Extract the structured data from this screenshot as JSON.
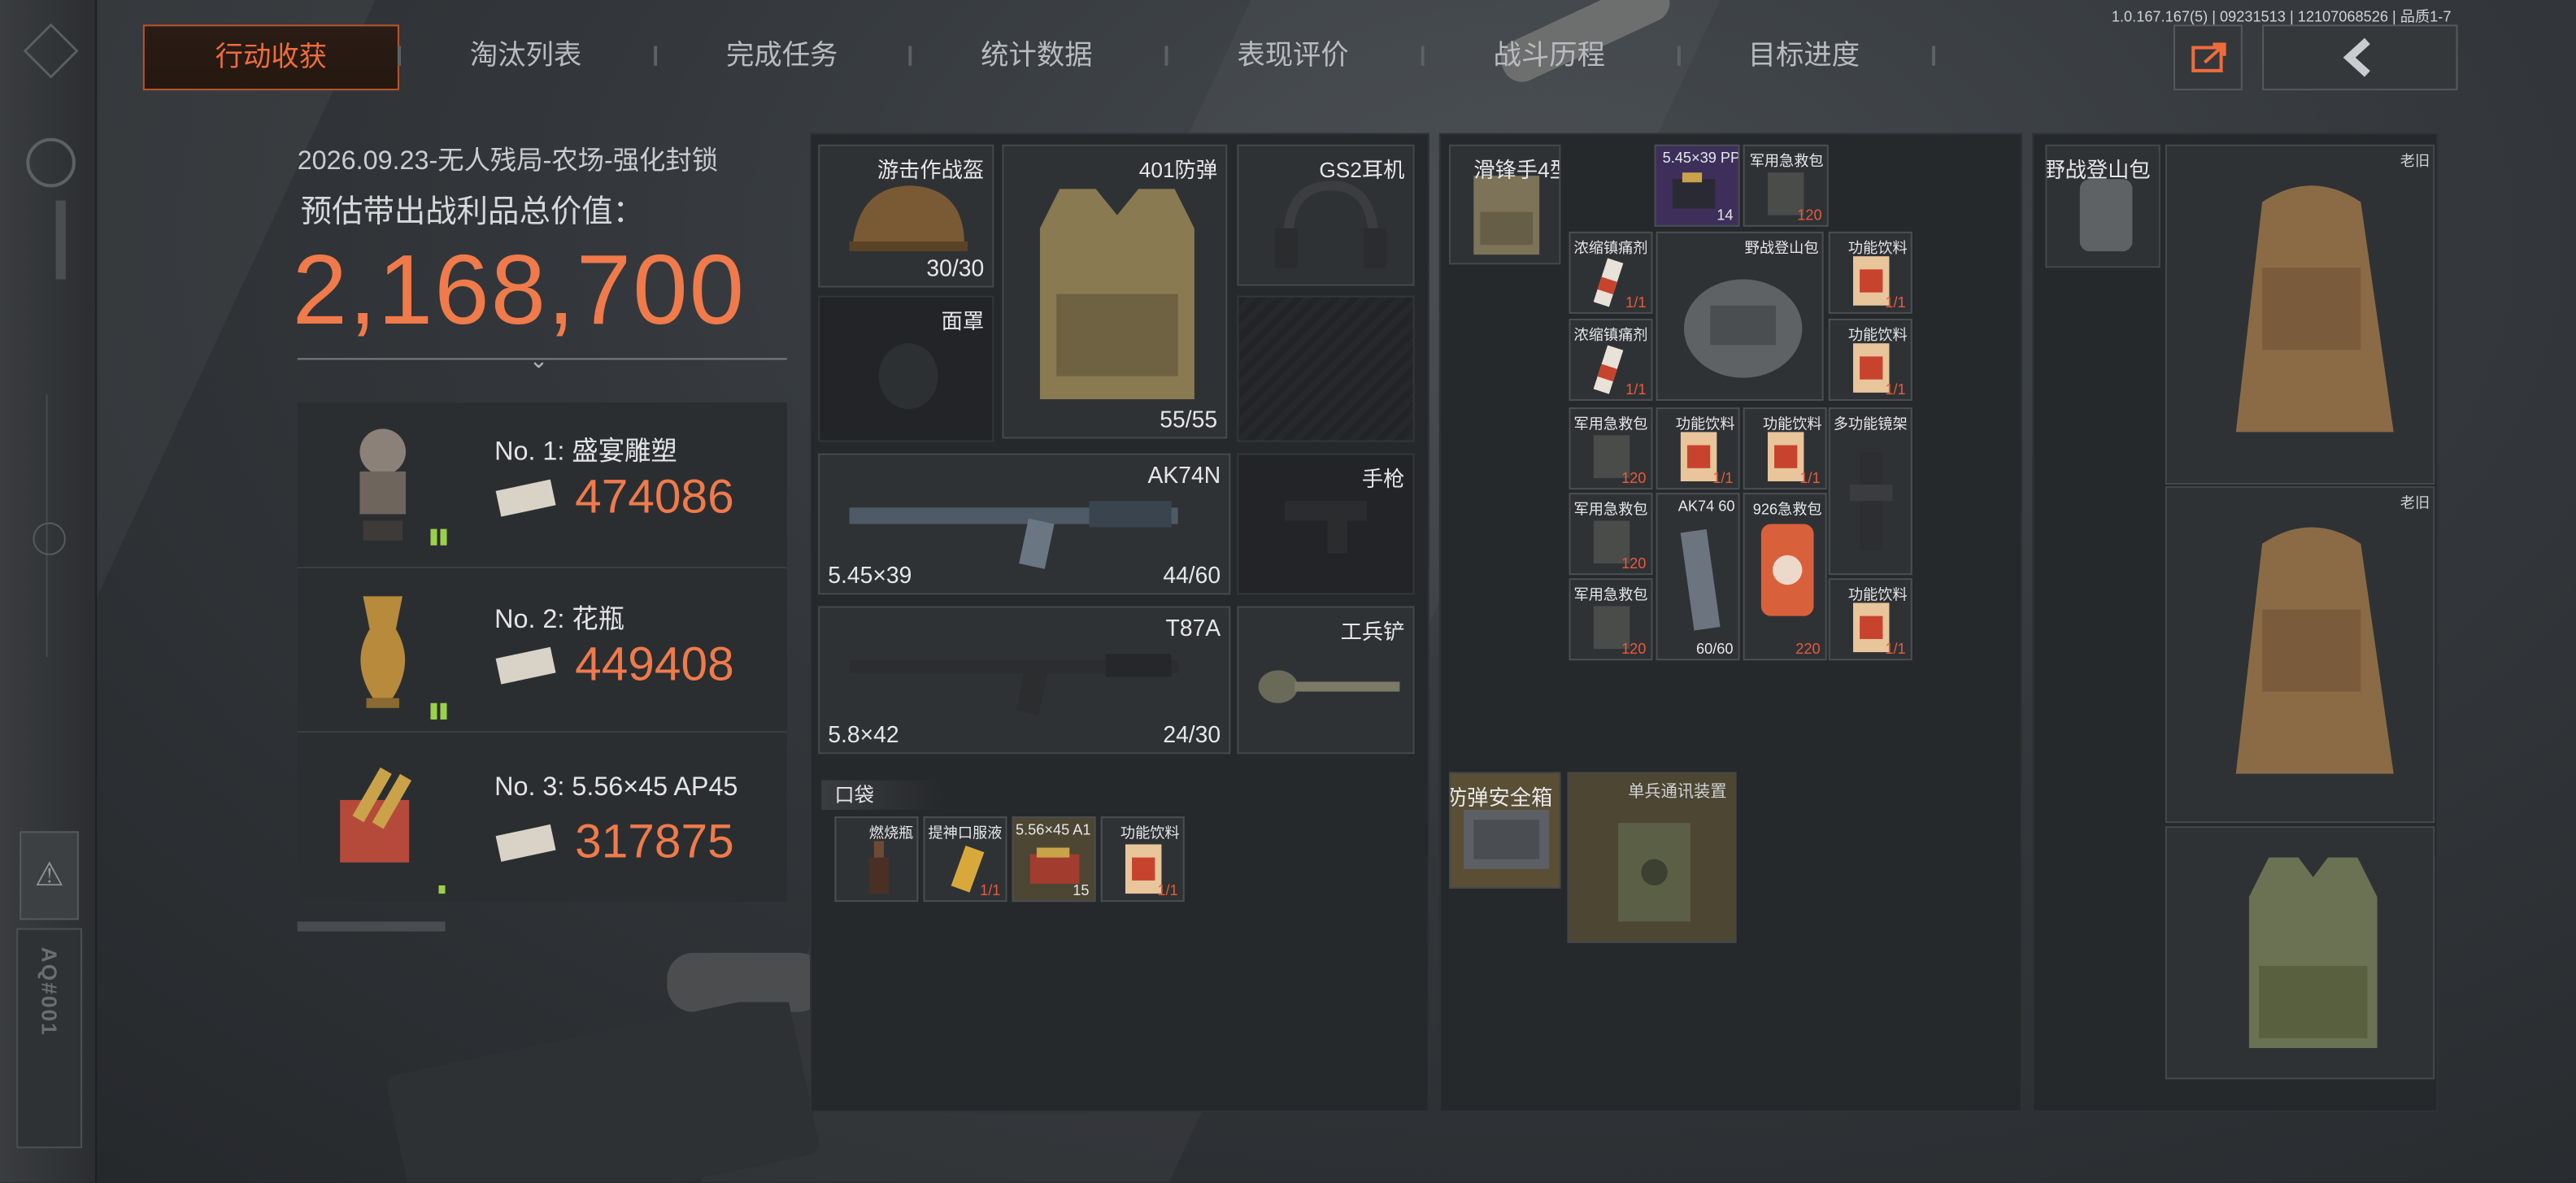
{
  "version": "1.0.167.167(5) | 09231513 | 12107068526 | 品质1-7",
  "tabs": [
    "行动收获",
    "淘汰列表",
    "完成任务",
    "统计数据",
    "表现评价",
    "战斗历程",
    "目标进度"
  ],
  "summary": {
    "title": "2026.09.23-无人残局-农场-强化封锁",
    "value_label": "预估带出战利品总价值：",
    "total_value": "2,168,700"
  },
  "top_items": [
    {
      "rank": "No. 1: 盛宴雕塑",
      "value": "474086"
    },
    {
      "rank": "No. 2: 花瓶",
      "value": "449408"
    },
    {
      "rank": "No. 3: 5.56×45 AP45",
      "value": "317875"
    }
  ],
  "gear": {
    "helmet": {
      "name": "游击作战盔",
      "durability": "30/30"
    },
    "armor": {
      "name": "401防弹",
      "durability": "55/55"
    },
    "headset": {
      "name": "GS2耳机"
    },
    "mask": {
      "name": "面罩"
    },
    "primary": {
      "name": "AK74N",
      "caliber": "5.45×39",
      "ammo": "44/60"
    },
    "secondary": {
      "name": "T87A",
      "caliber": "5.8×42",
      "ammo": "24/30"
    },
    "pistol": {
      "name": "手枪"
    },
    "melee": {
      "name": "工兵铲"
    }
  },
  "pocket": {
    "label": "口袋",
    "items": [
      {
        "name": "燃烧瓶",
        "count": ""
      },
      {
        "name": "提神口服液",
        "count": "1/1"
      },
      {
        "name": "5.56×45 A1",
        "count": "15"
      },
      {
        "name": "功能饮料",
        "count": "1/1"
      }
    ]
  },
  "rig": {
    "name": "滑锋手4型",
    "items": [
      {
        "name": "5.45×39 PP",
        "count": "14"
      },
      {
        "name": "军用急救包",
        "count": "120"
      },
      {
        "name": "浓缩镇痛剂",
        "count": "1/1"
      },
      {
        "name": "野战登山包",
        "count": ""
      },
      {
        "name": "功能饮料",
        "count": "1/1"
      },
      {
        "name": "浓缩镇痛剂",
        "count": "1/1"
      },
      {
        "name": "功能饮料",
        "count": "1/1"
      },
      {
        "name": "军用急救包",
        "count": "120"
      },
      {
        "name": "功能饮料",
        "count": "1/1"
      },
      {
        "name": "功能饮料",
        "count": "1/1"
      },
      {
        "name": "多功能镜架",
        "count": ""
      },
      {
        "name": "军用急救包",
        "count": "120"
      },
      {
        "name": "AK74 60",
        "count": "60/60"
      },
      {
        "name": "926急救包",
        "count": "220"
      },
      {
        "name": "军用急救包",
        "count": "120"
      },
      {
        "name": "功能饮料",
        "count": "1/1"
      }
    ]
  },
  "safe_box": {
    "name": "防弹安全箱"
  },
  "comm_device": {
    "name": "单兵通讯装置"
  },
  "backpack": {
    "name": "野战登山包"
  },
  "right_column": {
    "tag": "老旧"
  },
  "left_strip": {
    "code": "AQ#001",
    "warn_icon": "warning-triangle-icon"
  },
  "colors": {
    "accent": "#f07a4a",
    "red_count": "#e75a3c",
    "green_marker": "#9bd14a"
  }
}
